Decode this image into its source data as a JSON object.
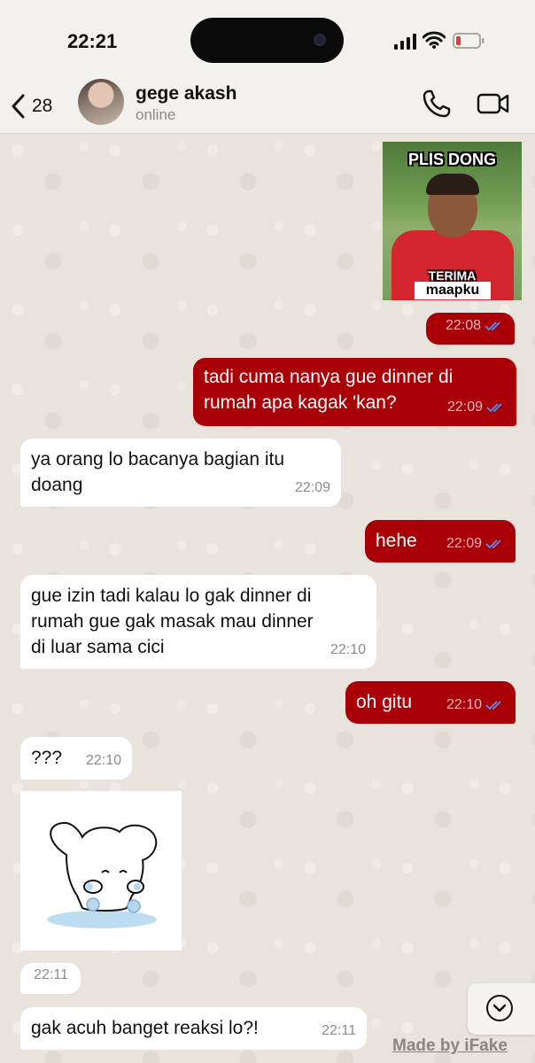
{
  "status_bar": {
    "time": "22:21"
  },
  "header": {
    "back_count": "28",
    "contact_name": "gege akash",
    "contact_status": "online"
  },
  "messages": [
    {
      "kind": "sticker",
      "direction": "outgoing",
      "caption_top": "PLIS DONG",
      "caption_bottom_1": "TERIMA",
      "caption_bottom_2": "maapku",
      "time": "22:08",
      "read": true
    },
    {
      "kind": "text",
      "direction": "outgoing",
      "lines": [
        "tadi cuma nanya gue dinner di",
        "rumah apa kagak 'kan?"
      ],
      "time": "22:09",
      "read": true
    },
    {
      "kind": "text",
      "direction": "incoming",
      "lines": [
        "ya orang lo bacanya bagian itu",
        "doang"
      ],
      "time": "22:09"
    },
    {
      "kind": "text",
      "direction": "outgoing",
      "lines": [
        "hehe"
      ],
      "time": "22:09",
      "read": true
    },
    {
      "kind": "text",
      "direction": "incoming",
      "lines": [
        "gue izin tadi kalau lo gak dinner di",
        "rumah gue gak masak mau dinner",
        "di luar sama cici"
      ],
      "time": "22:10"
    },
    {
      "kind": "text",
      "direction": "outgoing",
      "lines": [
        "oh gitu"
      ],
      "time": "22:10",
      "read": true
    },
    {
      "kind": "text",
      "direction": "incoming",
      "lines": [
        "???"
      ],
      "time": "22:10"
    },
    {
      "kind": "sticker",
      "direction": "incoming",
      "time": "22:11"
    },
    {
      "kind": "text",
      "direction": "incoming",
      "lines": [
        "gak acuh banget reaksi lo?!"
      ],
      "time": "22:11"
    }
  ],
  "watermark": "Made by iFake",
  "colors": {
    "outgoing_bubble": "#a90008",
    "incoming_bubble": "#ffffff",
    "read_ticks": "#5b8ef5"
  },
  "icons": [
    "signal-icon",
    "wifi-icon",
    "battery-icon",
    "back-chevron-icon",
    "phone-icon",
    "video-icon",
    "check-icon",
    "scroll-down-icon"
  ]
}
